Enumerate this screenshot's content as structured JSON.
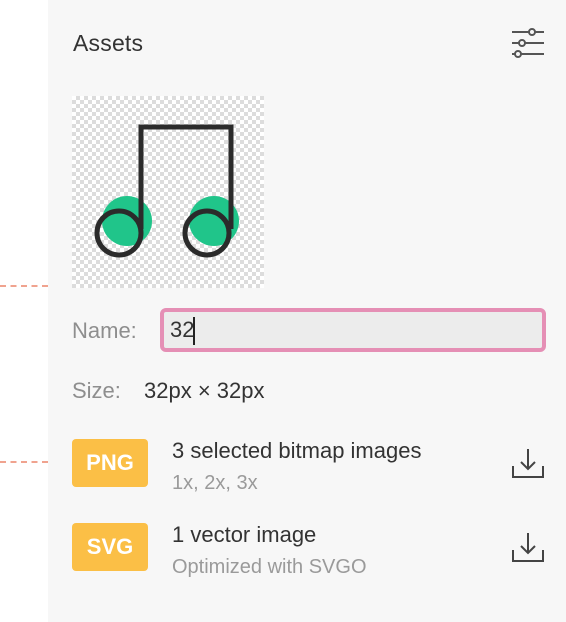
{
  "panel": {
    "title": "Assets",
    "settings_icon": "sliders-icon"
  },
  "preview": {
    "icon": "music-note-icon",
    "note_fill_color": "#20c58a",
    "note_stroke_color": "#2b2b2b"
  },
  "name_field": {
    "label": "Name:",
    "value": "32"
  },
  "size": {
    "label": "Size:",
    "value": "32px × 32px"
  },
  "exports": [
    {
      "badge": "PNG",
      "title": "3 selected bitmap images",
      "subtitle": "1x, 2x, 3x",
      "action_icon": "download-icon"
    },
    {
      "badge": "SVG",
      "title": "1 vector image",
      "subtitle": "Optimized with SVGO",
      "action_icon": "download-icon"
    }
  ],
  "colors": {
    "badge": "#fbbf46",
    "input_border": "#e58fb5",
    "panel_bg": "#f7f7f7",
    "canvas_guide": "#f0a38f"
  }
}
